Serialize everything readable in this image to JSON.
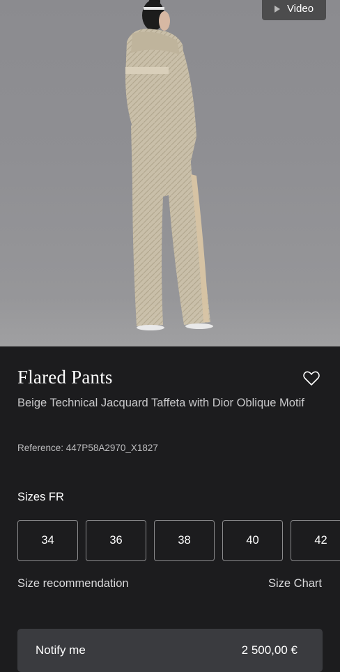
{
  "media": {
    "video_label": "Video",
    "play_icon": "play-icon"
  },
  "product": {
    "name": "Flared Pants",
    "description": "Beige Technical Jacquard Taffeta with Dior Oblique Motif",
    "reference": "Reference: 447P58A2970_X1827",
    "wishlist_icon": "heart-icon"
  },
  "sizes": {
    "label": "Sizes FR",
    "options": [
      "34",
      "36",
      "38",
      "40",
      "42"
    ],
    "recommendation_label": "Size recommendation",
    "chart_label": "Size Chart"
  },
  "purchase": {
    "notify_label": "Notify me",
    "price": "2 500,00 €"
  },
  "colors": {
    "background": "#1c1c1e",
    "notify_bar": "#3a3b3f",
    "hero_bg": "#8f8f93"
  }
}
